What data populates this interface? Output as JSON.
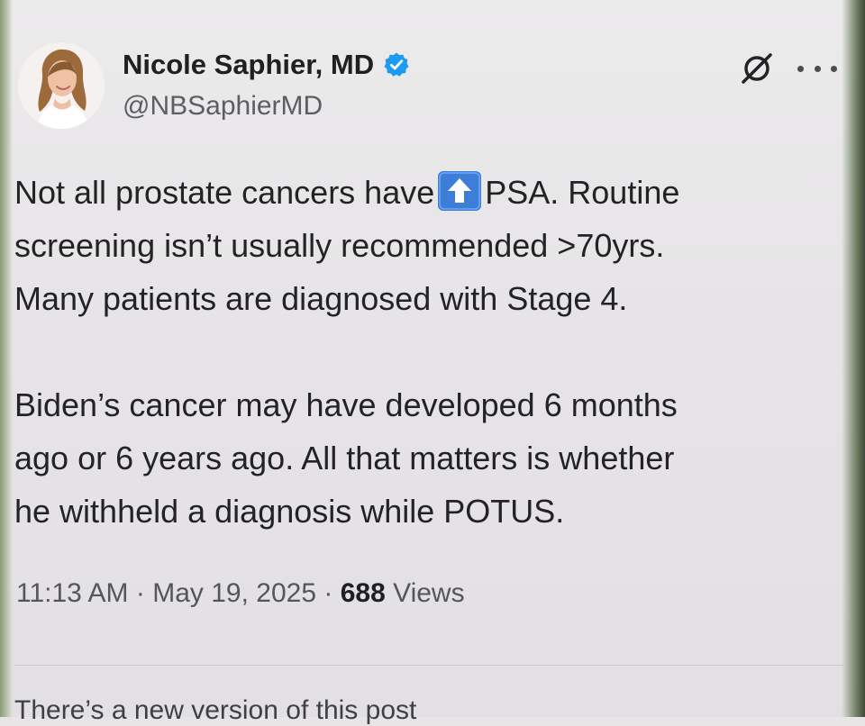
{
  "author": {
    "display_name": "Nicole Saphier, MD",
    "handle": "@NBSaphierMD",
    "verified": true
  },
  "icons": {
    "avatar": "profile-photo",
    "verified": "verified-badge-icon",
    "grok": "grok-icon",
    "more": "more-options-icon",
    "arrow": "up-arrow-emoji"
  },
  "post": {
    "line_1_before_emoji": "Not all prostate cancers have",
    "line_1_after_emoji": "PSA. Routine",
    "rest_of_paragraph_1": "screening isn’t usually recommended >70yrs.\nMany patients are diagnosed with Stage 4.",
    "paragraph_2": "Biden’s cancer may have developed 6 months\nago or 6 years ago. All that matters is whether\nhe withheld a diagnosis while POTUS."
  },
  "meta": {
    "time": "11:13 AM",
    "separator_1": "·",
    "date": "May 19, 2025",
    "separator_2": "·",
    "views_count": "688",
    "views_label": "Views"
  },
  "notice": {
    "text": "There’s a new version of this post"
  },
  "colors": {
    "verified_blue": "#1d9bf0",
    "emoji_blue": "#3d7ed8",
    "text": "#232326",
    "muted": "#5d5e63"
  }
}
